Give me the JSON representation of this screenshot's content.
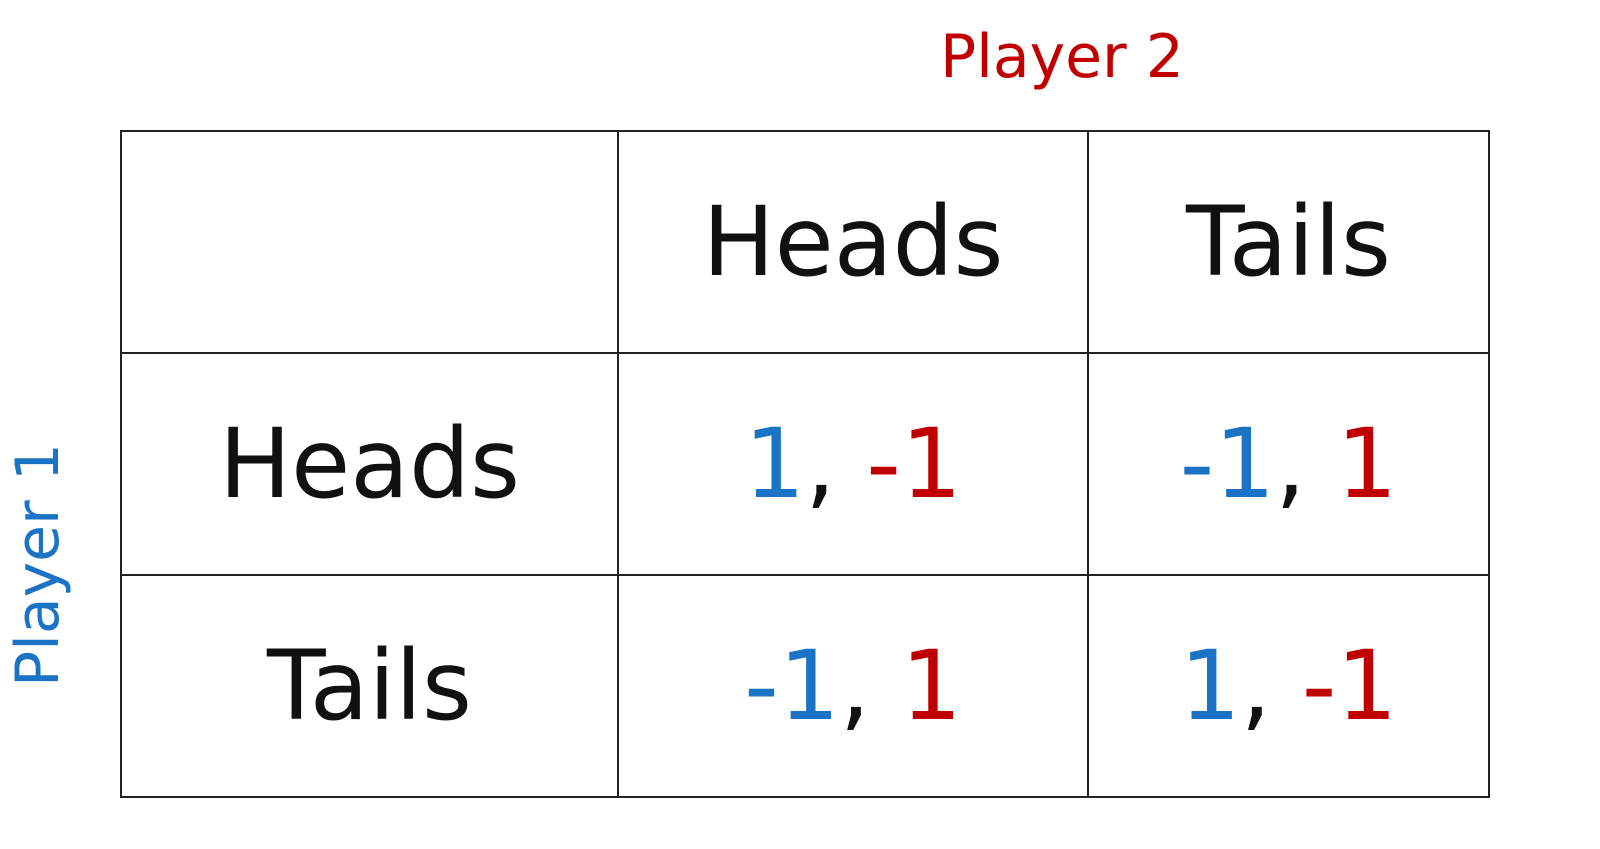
{
  "labels": {
    "player2": "Player 2",
    "player1": "Player 1"
  },
  "colors": {
    "player1": "#1a73c4",
    "player2": "#c00000",
    "text": "#111111",
    "grid": "#222222"
  },
  "matrix": {
    "column_headers": [
      "Heads",
      "Tails"
    ],
    "row_headers": [
      "Heads",
      "Tails"
    ],
    "separator": ",",
    "payoffs": [
      [
        {
          "p1": "1",
          "p2": "-1"
        },
        {
          "p1": "-1",
          "p2": "1"
        }
      ],
      [
        {
          "p1": "-1",
          "p2": "1"
        },
        {
          "p1": "1",
          "p2": "-1"
        }
      ]
    ]
  }
}
